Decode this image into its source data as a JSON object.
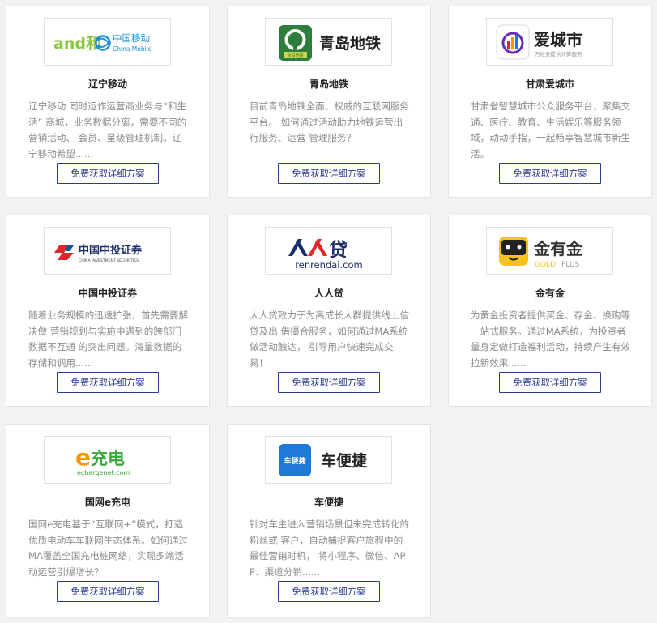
{
  "cards": [
    {
      "title": "辽宁移动",
      "desc": "辽宁移动 同时运作运营商业务与“和生活” 商城，业务数据分离，需要不同的营销活动、 会员、星级管理机制。辽宁移动希望......",
      "button": "免费获取详细方案",
      "logo": {
        "mark": "and和",
        "name": "中国移动",
        "sub": "China Mobile"
      }
    },
    {
      "title": "青岛地铁",
      "desc": "目前青岛地铁全面、权威的互联网服务平台。 如何通过活动助力地铁运营出行服务、运营 管理服务？",
      "button": "免费获取详细方案",
      "logo": {
        "name": "青岛地铁",
        "badge": "青岛地铁"
      }
    },
    {
      "title": "甘肃爱城市",
      "desc": "甘肃省智慧城市公众服务平台，聚集交通、医疗、教育、生活娱乐等服务领域，动动手指，一起畅享智慧城市新生活。",
      "button": "免费获取详细方案",
      "logo": {
        "name": "爱城市",
        "sub": "万维云提供计算服务"
      }
    },
    {
      "title": "中国中投证券",
      "desc": "随着业务规模的迅速扩张，首先需要解决做 营销规划与实施中遇到的跨部门数据不互通 的突出问题。海量数据的存储和调用......",
      "button": "免费获取详细方案",
      "logo": {
        "name": "中国中投证券",
        "sub": "CHINA INVESTMENT SECURITIES"
      }
    },
    {
      "title": "人人贷",
      "desc": "人人贷致力于为高成长人群提供线上信贷及出 借撮合服务，如何通过MA系统做活动触达， 引导用户快速完成交易！",
      "button": "免费获取详细方案",
      "logo": {
        "name": "贷",
        "sub": "renrendai.com"
      }
    },
    {
      "title": "金有金",
      "desc": "为黄金投资者提供买金、存金、换购等一站式服务。通过MA系统，为投资者量身定做打造福利活动，持续产生有效拉新效果......",
      "button": "免费获取详细方案",
      "logo": {
        "name": "金有金",
        "sub1": "GOLD",
        "sub2": "PLUS"
      }
    },
    {
      "title": "国网e充电",
      "desc": "国网e充电基于“互联网+”模式，打造优质电动车车联网生态体系。如何通过MA覆盖全国充电桩网络，实现多端活动运营引爆增长？",
      "button": "免费获取详细方案",
      "logo": {
        "mark": "e",
        "name": "充电",
        "sub": "echargenet.com"
      }
    },
    {
      "title": "车便捷",
      "desc": "针对车主进入营销场景但未完成转化的粉丝或 客户，自动捕捉客户旅程中的最佳营销时机， 将小程序、微信、APP、渠道分销......",
      "button": "免费获取详细方案",
      "logo": {
        "badge": "车便捷",
        "name": "车便捷"
      }
    }
  ],
  "colors": {
    "button_border": "#2c3a8f",
    "china_mobile_blue": "#1a8fd6",
    "and_green": "#8cc63f",
    "qingdao_green": "#2f7d3c",
    "renrendai_navy": "#1b2d6b",
    "renrendai_red": "#e0262b",
    "echarge_green": "#3aa83a",
    "echarge_orange": "#f39800",
    "cbj_blue": "#1e79d8",
    "gold_yellow": "#f6c21b"
  }
}
